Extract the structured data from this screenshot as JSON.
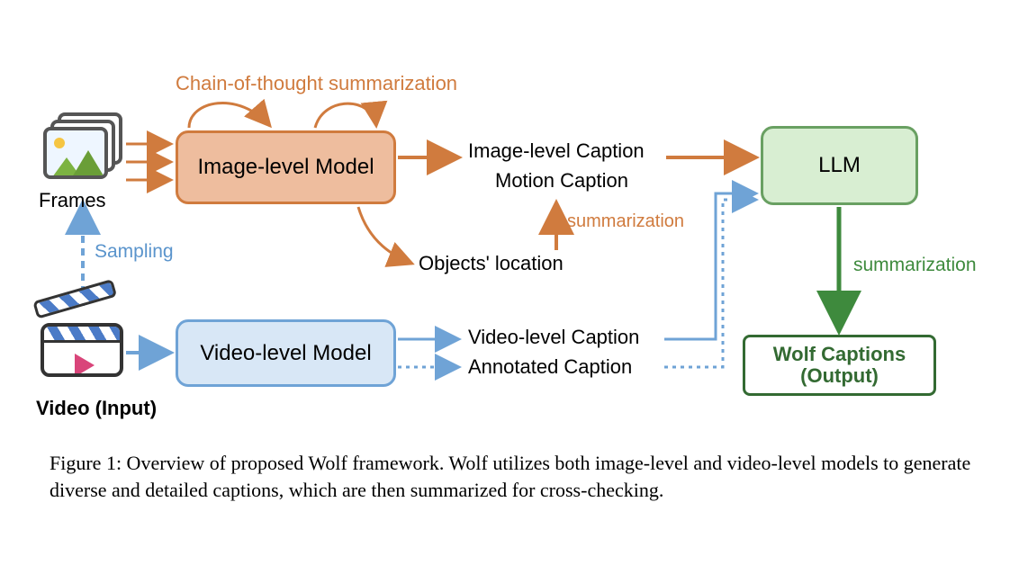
{
  "labels": {
    "cot": "Chain-of-thought summarization",
    "frames": "Frames",
    "sampling": "Sampling",
    "video_input": "Video (Input)",
    "image_model": "Image-level Model",
    "video_model": "Video-level Model",
    "image_caption": "Image-level Caption",
    "motion_caption": "Motion Caption",
    "summarization_small": "summarization",
    "objects_location": "Objects' location",
    "video_caption": "Video-level Caption",
    "annotated_caption": "Annotated Caption",
    "llm": "LLM",
    "summarization_green": "summarization",
    "output_line1": "Wolf Captions",
    "output_line2": "(Output)"
  },
  "caption": "Figure 1: Overview of proposed Wolf framework. Wolf utilizes both image-level and video-level models to generate diverse and detailed captions, which are then summarized for cross-checking."
}
